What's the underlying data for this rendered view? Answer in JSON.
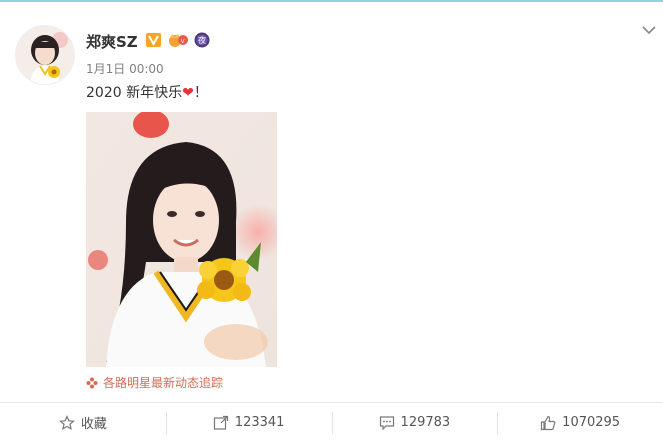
{
  "post": {
    "author": "郑爽SZ",
    "time": "1月1日 00:00",
    "text": "2020 新年快乐",
    "text_emoji": "❤",
    "text_suffix": "！",
    "topic_link": "各路明星最新动态追踪"
  },
  "actions": {
    "favorite_label": "收藏",
    "repost_count": "123341",
    "comment_count": "129783",
    "like_count": "1070295"
  },
  "icons": {
    "verified": "verified-v-icon",
    "vip": "vip-crown-icon",
    "night": "night-badge-icon",
    "menu": "chevron-down-icon",
    "favorite": "star-icon",
    "repost": "repost-icon",
    "comment": "comment-icon",
    "like": "thumbs-up-icon",
    "topic": "flower-icon"
  },
  "colors": {
    "verified": "#f5a623",
    "heart": "#e8323c",
    "topic": "#d46b52",
    "accent_line": "#8fd4e0"
  }
}
